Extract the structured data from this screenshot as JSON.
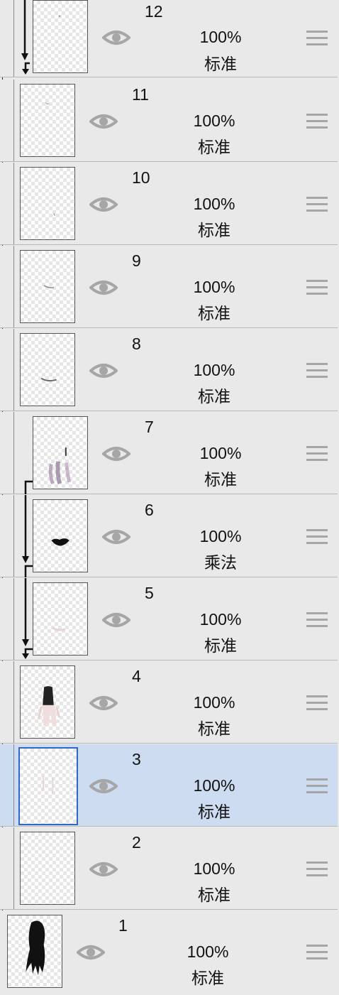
{
  "layers_panel": {
    "layers": [
      {
        "name": "12",
        "opacity": "100%",
        "blend": "标准",
        "clipped": true,
        "selected": false
      },
      {
        "name": "11",
        "opacity": "100%",
        "blend": "标准",
        "clipped": false,
        "selected": false
      },
      {
        "name": "10",
        "opacity": "100%",
        "blend": "标准",
        "clipped": false,
        "selected": false
      },
      {
        "name": "9",
        "opacity": "100%",
        "blend": "标准",
        "clipped": false,
        "selected": false
      },
      {
        "name": "8",
        "opacity": "100%",
        "blend": "标准",
        "clipped": false,
        "selected": false
      },
      {
        "name": "7",
        "opacity": "100%",
        "blend": "标准",
        "clipped": true,
        "selected": false
      },
      {
        "name": "6",
        "opacity": "100%",
        "blend": "乘法",
        "clipped": true,
        "selected": false
      },
      {
        "name": "5",
        "opacity": "100%",
        "blend": "标准",
        "clipped": true,
        "selected": false
      },
      {
        "name": "4",
        "opacity": "100%",
        "blend": "标准",
        "clipped": false,
        "selected": false
      },
      {
        "name": "3",
        "opacity": "100%",
        "blend": "标准",
        "clipped": false,
        "selected": true
      },
      {
        "name": "2",
        "opacity": "100%",
        "blend": "标准",
        "clipped": false,
        "selected": false
      },
      {
        "name": "1",
        "opacity": "100%",
        "blend": "标准",
        "clipped": false,
        "selected": false
      }
    ],
    "icons": {
      "visibility": "eye-icon",
      "reorder": "drag-handle-icon",
      "clip": "clipping-arrow-icon"
    },
    "colors": {
      "background": "#e9e9e9",
      "selected_row": "#cddcf0",
      "selected_border": "#2f67c8",
      "icon_gray": "#a6a6a6"
    }
  }
}
